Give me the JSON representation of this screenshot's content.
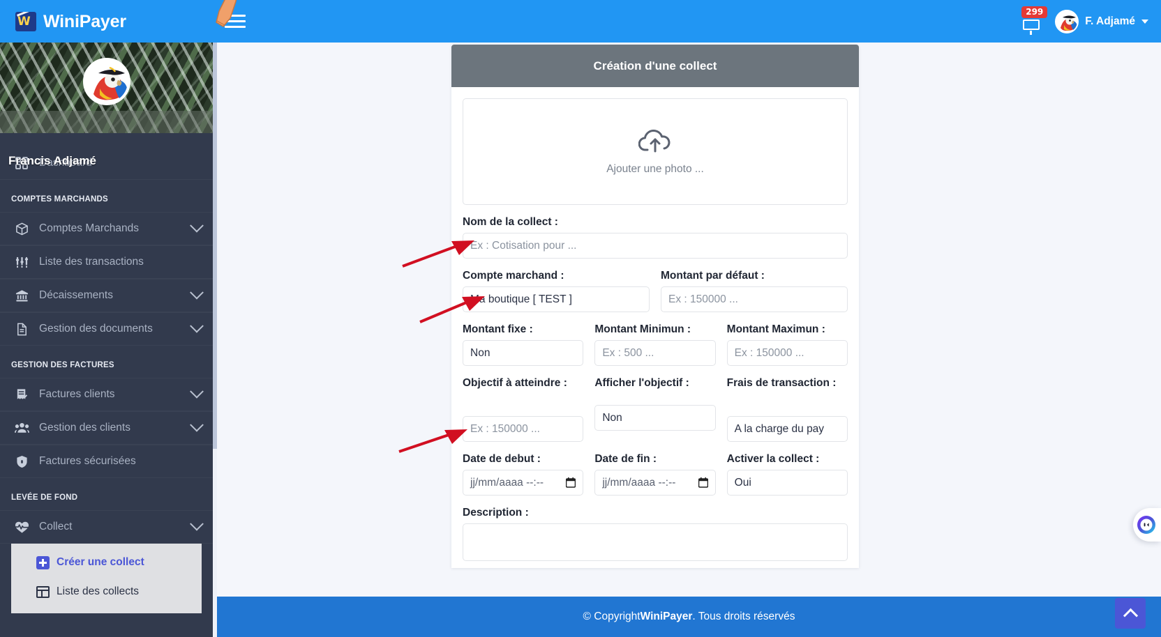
{
  "navbar": {
    "brand": "WiniPayer",
    "menu_toggle_label": "menu",
    "notification_count": "299",
    "user_name": "F. Adjamé"
  },
  "sidebar": {
    "profile_name": "Francis Adjamé",
    "dashboard": {
      "label": "Dashboard",
      "icon": "grid-icon"
    },
    "sections": [
      {
        "title": "COMPTES MARCHANDS",
        "items": [
          {
            "label": "Comptes Marchands",
            "icon": "box-icon",
            "expandable": true
          },
          {
            "label": "Liste des transactions",
            "icon": "sliders-icon",
            "expandable": false
          },
          {
            "label": "Décaissements",
            "icon": "bank-icon",
            "expandable": true
          },
          {
            "label": "Gestion des documents",
            "icon": "document-icon",
            "expandable": true
          }
        ]
      },
      {
        "title": "GESTION DES FACTURES",
        "items": [
          {
            "label": "Factures clients",
            "icon": "receipt-check-icon",
            "expandable": true
          },
          {
            "label": "Gestion des clients",
            "icon": "people-icon",
            "expandable": true
          },
          {
            "label": "Factures sécurisées",
            "icon": "shield-lock-icon",
            "expandable": false
          }
        ]
      },
      {
        "title": "LEVÉE DE FOND",
        "items": [
          {
            "label": "Collect",
            "icon": "heartbeat-icon",
            "expandable": true
          }
        ],
        "submenu": [
          {
            "label": "Créer une collect",
            "icon": "plus-square-icon",
            "active": true
          },
          {
            "label": "Liste des collects",
            "icon": "table-icon",
            "active": false
          }
        ]
      }
    ]
  },
  "card": {
    "title": "Création d'une collect",
    "dropzone": {
      "text": "Ajouter une photo ...",
      "icon": "cloud-upload-icon"
    },
    "fields": [
      {
        "label": "Nom de la collect :",
        "value": "",
        "placeholder": "Ex : Cotisation pour ...",
        "type": "text"
      },
      {
        "label": "Compte marchand :",
        "value": "Ma boutique [ TEST ]",
        "placeholder": "",
        "type": "select"
      },
      {
        "label": "Montant par défaut :",
        "value": "",
        "placeholder": "Ex : 150000 ...",
        "type": "number"
      },
      {
        "label": "Montant fixe :",
        "value": "Non",
        "placeholder": "",
        "type": "select"
      },
      {
        "label": "Montant Minimun :",
        "value": "",
        "placeholder": "Ex : 500 ...",
        "type": "number"
      },
      {
        "label": "Montant Maximun :",
        "value": "",
        "placeholder": "Ex : 150000 ...",
        "type": "number"
      },
      {
        "label": "Objectif à atteindre :",
        "value": "",
        "placeholder": "Ex : 150000 ...",
        "type": "number"
      },
      {
        "label": "Afficher l'objectif :",
        "value": "Non",
        "placeholder": "",
        "type": "select"
      },
      {
        "label": "Frais de transaction :",
        "value": "A la charge du pay",
        "placeholder": "",
        "type": "select"
      },
      {
        "label": "Date de debut :",
        "value": "jj/mm/aaaa --:--",
        "placeholder": "",
        "type": "datetime"
      },
      {
        "label": "Date de fin :",
        "value": "jj/mm/aaaa --:--",
        "placeholder": "",
        "type": "datetime"
      },
      {
        "label": "Activer la collect :",
        "value": "Oui",
        "placeholder": "",
        "type": "select"
      },
      {
        "label": "Description :",
        "value": "",
        "placeholder": "",
        "type": "textarea"
      }
    ]
  },
  "footer": {
    "prefix": "© Copyright ",
    "brand": "WiniPayer",
    "suffix": ". Tous droits réservés"
  },
  "widgets": {
    "scroll_top": "scroll-to-top",
    "chat": "chat-widget"
  },
  "colors": {
    "navbar_blue": "#2196f3",
    "sidebar_dark": "#323a4d",
    "card_header_gray": "#6c757d",
    "footer_blue": "#2176d2",
    "accent_indigo": "#4b56d6",
    "badge_red": "#e53935",
    "annotation_red": "#d10f21"
  }
}
